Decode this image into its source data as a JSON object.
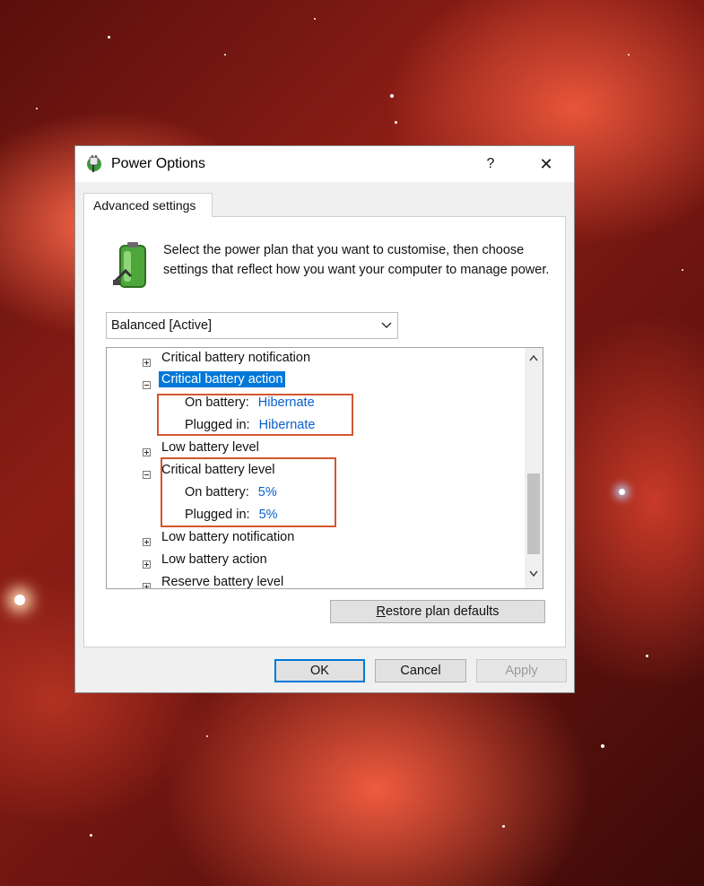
{
  "window": {
    "title": "Power Options",
    "help_label": "?",
    "close_label": "✕"
  },
  "tab": {
    "label": "Advanced settings"
  },
  "description": "Select the power plan that you want to customise, then choose settings that reflect how you want your computer to manage power.",
  "plan_select": {
    "value": "Balanced [Active]"
  },
  "tree": {
    "critical_notification": "Critical battery notification",
    "critical_action": "Critical battery action",
    "critical_action_on_battery_label": "On battery:",
    "critical_action_on_battery_value": "Hibernate",
    "critical_action_plugged_label": "Plugged in:",
    "critical_action_plugged_value": "Hibernate",
    "low_level": "Low battery level",
    "critical_level": "Critical battery level",
    "critical_level_on_battery_label": "On battery:",
    "critical_level_on_battery_value": "5%",
    "critical_level_plugged_label": "Plugged in:",
    "critical_level_plugged_value": "5%",
    "low_notification": "Low battery notification",
    "low_action": "Low battery action",
    "reserve_level": "Reserve battery level"
  },
  "buttons": {
    "restore_first": "R",
    "restore_rest": "estore plan defaults",
    "ok": "OK",
    "cancel": "Cancel",
    "apply": "Apply"
  },
  "colors": {
    "selection": "#0078d7",
    "value_link": "#0a5fcd",
    "annotation_box": "#d2572f"
  }
}
